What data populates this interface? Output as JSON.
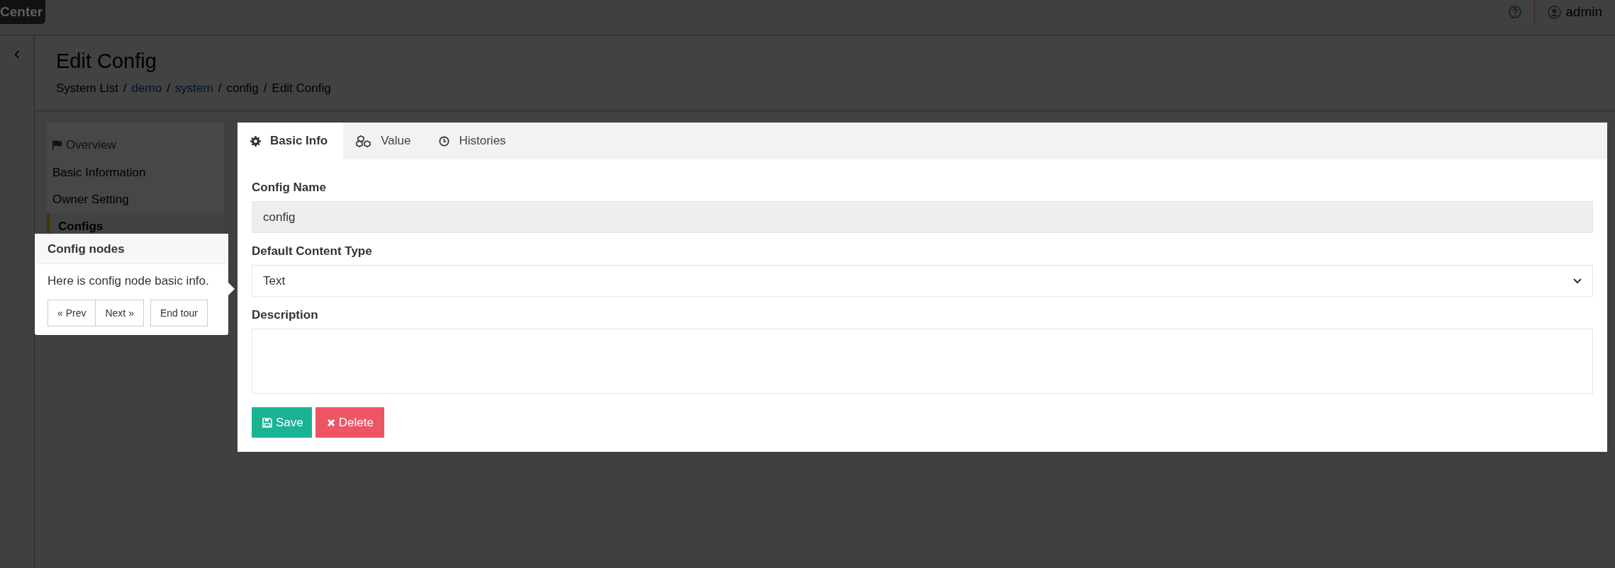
{
  "header": {
    "logo": "Center",
    "user": "admin"
  },
  "sidebar_toggle": "‹",
  "page": {
    "title": "Edit Config",
    "breadcrumb": [
      {
        "label": "System List",
        "link": false,
        "separator": "/"
      },
      {
        "label": "demo",
        "link": true,
        "separator": "/"
      },
      {
        "label": "system",
        "link": true,
        "separator": "/"
      },
      {
        "label": "config",
        "link": false,
        "separator": "/"
      },
      {
        "label": "Edit Config",
        "link": false
      }
    ]
  },
  "nav": {
    "heading": "Overview",
    "items": [
      {
        "label": "Basic Information",
        "selected": false
      },
      {
        "label": "Owner Setting",
        "selected": false
      },
      {
        "label": "Configs",
        "selected": true
      }
    ]
  },
  "tabs": [
    {
      "label": "Basic Info",
      "selected": true
    },
    {
      "label": "Value",
      "selected": false
    },
    {
      "label": "Histories",
      "selected": false
    }
  ],
  "form": {
    "fields": [
      {
        "kind": "input",
        "label": "Config Name",
        "value": "config",
        "disabled": true
      },
      {
        "kind": "select",
        "label": "Default Content Type",
        "value": "Text"
      },
      {
        "kind": "textarea",
        "label": "Description"
      }
    ]
  },
  "actions": [
    {
      "kind": "save",
      "label": "Save"
    },
    {
      "kind": "delete",
      "label": "Delete"
    }
  ],
  "tour": {
    "title": "Config nodes",
    "content": "Here is config node basic info.",
    "buttons": [
      {
        "kind": "prev",
        "label": "« Prev"
      },
      {
        "kind": "next",
        "label": "Next »"
      },
      {
        "kind": "end",
        "label": "End tour"
      }
    ]
  }
}
